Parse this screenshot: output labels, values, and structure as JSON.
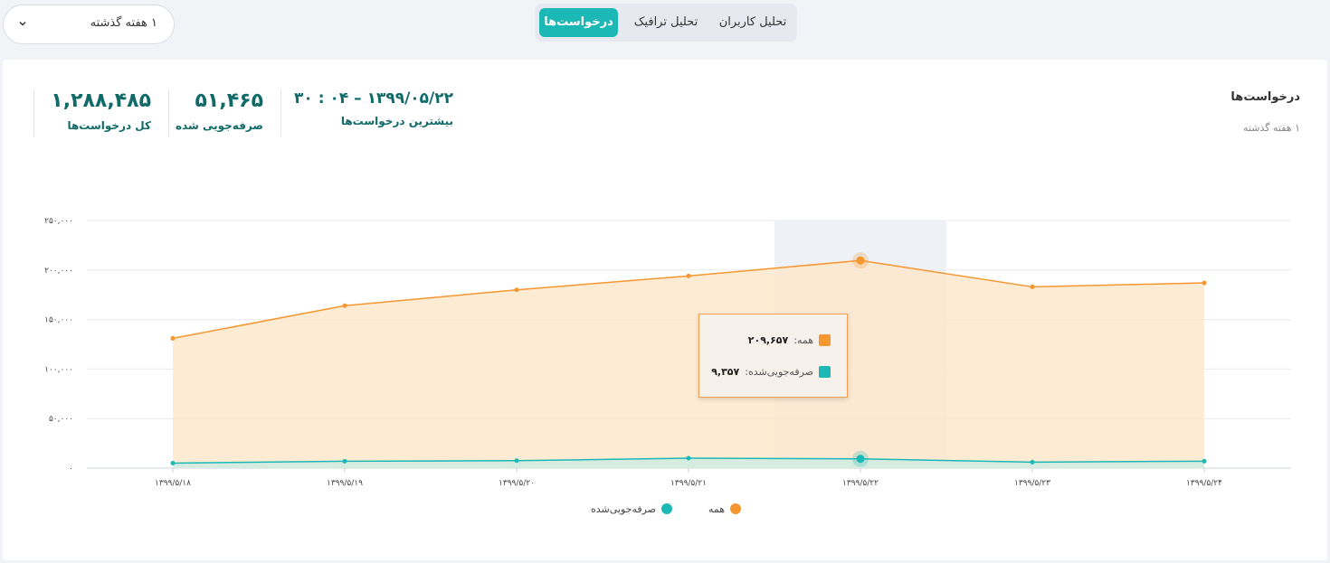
{
  "period_select": {
    "value": "۱ هفته گذشته"
  },
  "tabs": [
    {
      "label": "تحلیل کاربران",
      "active": false
    },
    {
      "label": "تحلیل ترافیک",
      "active": false
    },
    {
      "label": "درخواست‌ها",
      "active": true
    }
  ],
  "card": {
    "title": "درخواست‌ها",
    "subtitle": "۱ هفته گذشته"
  },
  "stats": {
    "peak": {
      "value": "۱۳۹۹/۰۵/۲۲ – ۰۴ : ۳۰",
      "label": "بیشترین درخواست‌ها"
    },
    "cached": {
      "value": "۵۱,۴۶۵",
      "label": "صرفه‌جویی شده"
    },
    "total": {
      "value": "۱,۲۸۸,۴۸۵",
      "label": "کل درخواست‌ها"
    }
  },
  "tooltip": {
    "rows": [
      {
        "label": "همه:",
        "value": "۲۰۹,۶۵۷"
      },
      {
        "label": "صرفه‌جویی‌شده:",
        "value": "۹,۳۵۷"
      }
    ]
  },
  "colors": {
    "all": "#f5962f",
    "all_fill": "#fde7cc",
    "cached": "#1cb8b5",
    "cached_fill": "#d3ece2",
    "highlight": "#eef1f6",
    "accent": "#1cb8b5",
    "stat_text": "#0f6a68"
  },
  "chart_data": {
    "type": "area",
    "x": [
      "۱۳۹۹/۵/۱۸",
      "۱۳۹۹/۵/۱۹",
      "۱۳۹۹/۵/۲۰",
      "۱۳۹۹/۵/۲۱",
      "۱۳۹۹/۵/۲۲",
      "۱۳۹۹/۵/۲۳",
      "۱۳۹۹/۵/۲۴"
    ],
    "series": [
      {
        "name": "همه",
        "values": [
          131000,
          164000,
          180000,
          194000,
          209657,
          183000,
          187000
        ]
      },
      {
        "name": "صرفه‌جویی‌شده",
        "values": [
          5000,
          7000,
          7500,
          10000,
          9357,
          6000,
          7000
        ]
      }
    ],
    "yticks": [
      "۰",
      "۵۰,۰۰۰",
      "۱۰۰,۰۰۰",
      "۱۵۰,۰۰۰",
      "۲۰۰,۰۰۰",
      "۲۵۰,۰۰۰"
    ],
    "ylim": [
      0,
      250000
    ],
    "highlight_index": 4,
    "legend_position": "bottom",
    "grid": true
  }
}
